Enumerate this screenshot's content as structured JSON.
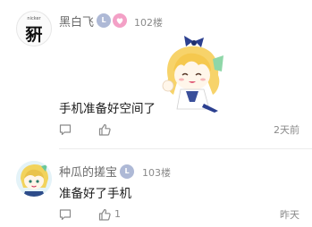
{
  "comments": [
    {
      "username": "黑白飞",
      "avatar_glyph": "豣",
      "avatar_caption": "nicker",
      "level_badge": "L",
      "floor": "102楼",
      "content": "手机准备好空间了",
      "time": "2天前",
      "like_count": "",
      "has_sticker": true
    },
    {
      "username": "种瓜的搓宝",
      "level_badge": "L",
      "floor": "103楼",
      "content": "准备好了手机",
      "time": "昨天",
      "like_count": "1"
    }
  ],
  "colors": {
    "username": "#6b6b6b",
    "meta": "#8a8a8a",
    "badge_blue": "#aeb9d6",
    "badge_pink": "#f3a0c6",
    "divider": "#ececec"
  }
}
